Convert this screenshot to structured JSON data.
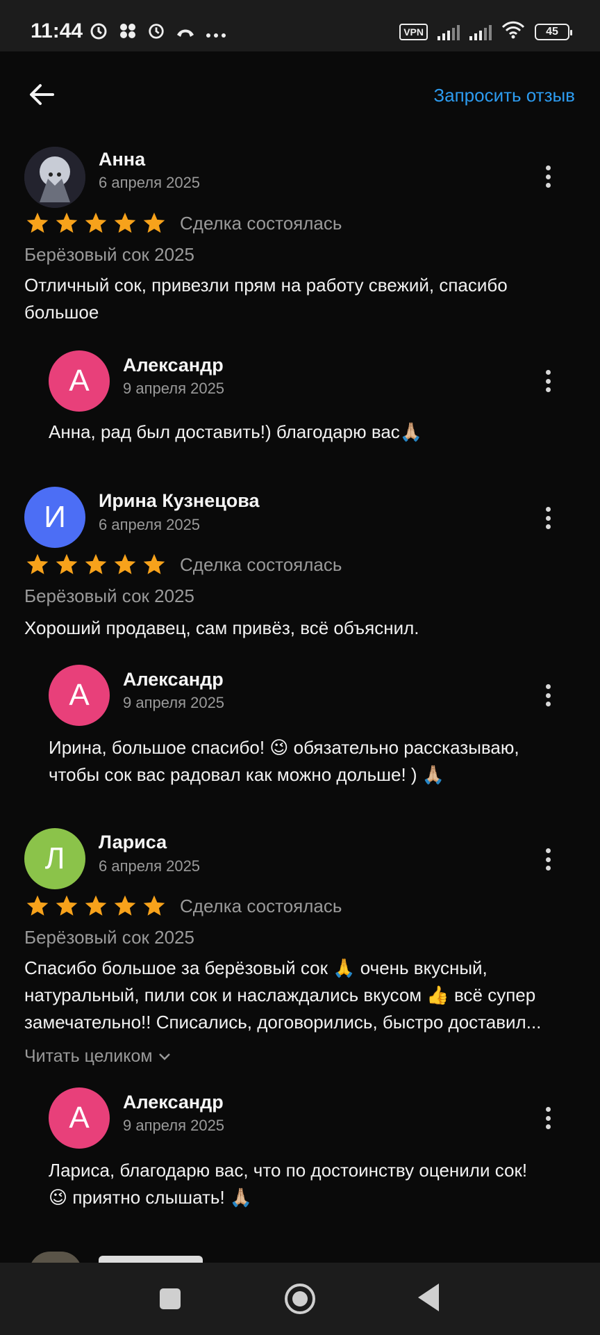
{
  "status_bar": {
    "time": "11:44",
    "left_icons": [
      "alarm-icon",
      "apps-icon",
      "alarm-icon",
      "call-icon",
      "more-icon"
    ],
    "vpn_label": "VPN",
    "battery": "45"
  },
  "top_bar": {
    "back_icon": "arrow-left-icon",
    "request_review": "Запросить отзыв"
  },
  "reviews": [
    {
      "name": "Анна",
      "date": "6 апреля 2025",
      "rating": 5,
      "deal_status": "Сделка состоялась",
      "product": "Берёзовый сок 2025",
      "text_lines": [
        "Отличный сок, привезли прям на работу свежий, спасибо",
        "большое"
      ],
      "reply": {
        "avatar_letter": "А",
        "name": "Александр",
        "date": "9 апреля 2025",
        "text_lines": [
          "Анна, рад был доставить!) благодарю вас🙏🏼"
        ]
      }
    },
    {
      "avatar_letter": "И",
      "name": "Ирина Кузнецова",
      "date": "6 апреля 2025",
      "rating": 5,
      "deal_status": "Сделка состоялась",
      "product": "Берёзовый сок 2025",
      "text_lines": [
        "Хороший продавец, сам привёз, всё объяснил."
      ],
      "reply": {
        "avatar_letter": "А",
        "name": "Александр",
        "date": "9 апреля 2025",
        "text_lines": [
          "Ирина, большое спасибо! 😉 обязательно рассказываю,",
          "чтобы сок вас радовал как можно дольше! ) 🙏🏼"
        ]
      }
    },
    {
      "avatar_letter": "Л",
      "name": "Лариса",
      "date": "6 апреля 2025",
      "rating": 5,
      "deal_status": "Сделка состоялась",
      "product": "Берёзовый сок 2025",
      "text_lines": [
        "Спасибо большое за берёзовый сок 🙏 очень вкусный,",
        "натуральный, пили сок и наслаждались вкусом 👍 всё супер",
        "замечательно!! Списались, договорились, быстро доставил..."
      ],
      "read_more": "Читать целиком",
      "reply": {
        "avatar_letter": "А",
        "name": "Александр",
        "date": "9 апреля 2025",
        "text_lines": [
          "Лариса, благодарю вас, что по достоинству оценили сок!",
          "😉 приятно слышать! 🙏🏼"
        ]
      }
    }
  ],
  "colors": {
    "accent": "#2d9cf0",
    "star": "#f7a21b",
    "avatar_pink": "#e8407a",
    "avatar_blue": "#4c6ef5",
    "avatar_green": "#8bc34a"
  }
}
